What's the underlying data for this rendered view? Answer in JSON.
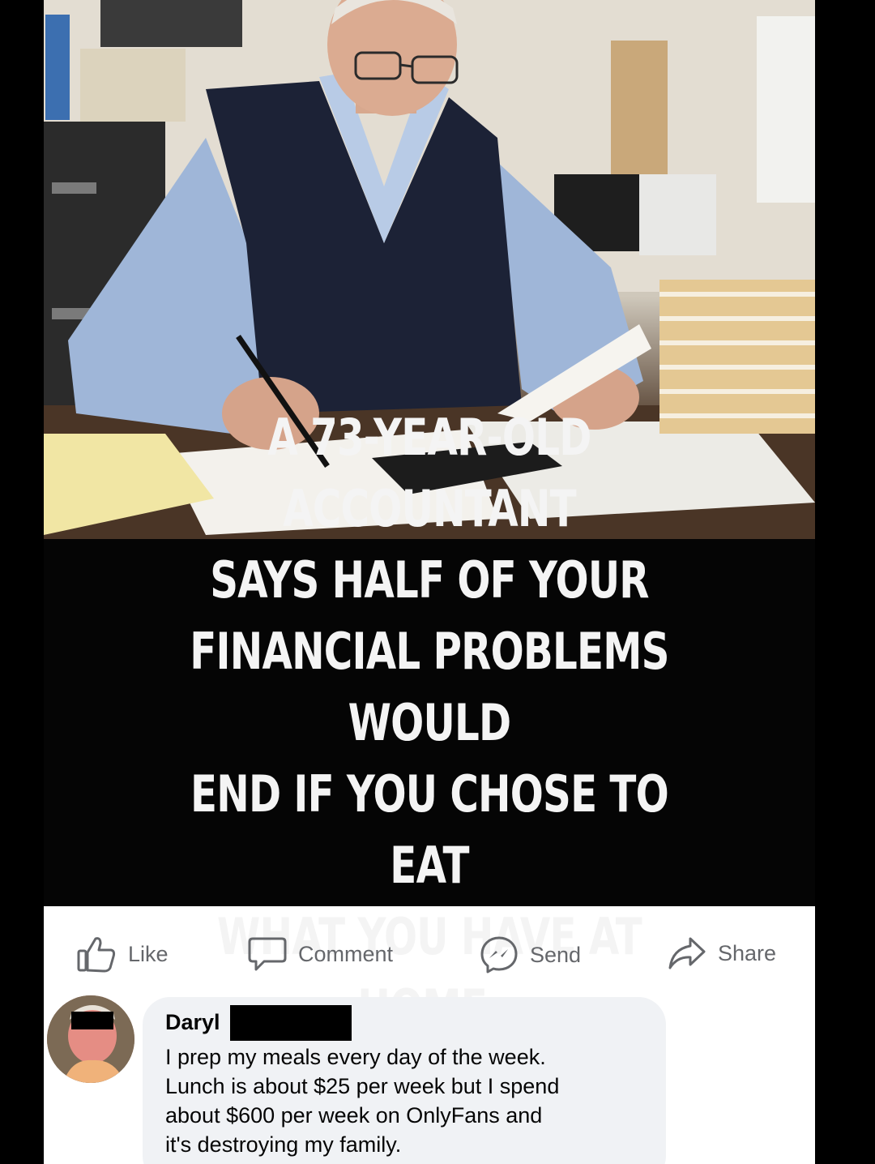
{
  "headline": {
    "text": "A 73-YEAR-OLD ACCOUNTANT\nSAYS  HALF OF YOUR\nFINANCIAL PROBLEMS WOULD\nEND IF YOU CHOSE TO EAT\nWHAT YOU HAVE AT HOME."
  },
  "actions": {
    "like": "Like",
    "comment": "Comment",
    "send": "Send",
    "share": "Share"
  },
  "comment": {
    "author": "Daryl",
    "text": "I prep my meals every day of the week.\nLunch is about $25 per week but I spend\nabout $600 per week on OnlyFans and\nit's destroying my family."
  },
  "colors": {
    "action_gray": "#65676b",
    "bubble_bg": "#f0f2f5",
    "headline_bg": "#050505"
  }
}
